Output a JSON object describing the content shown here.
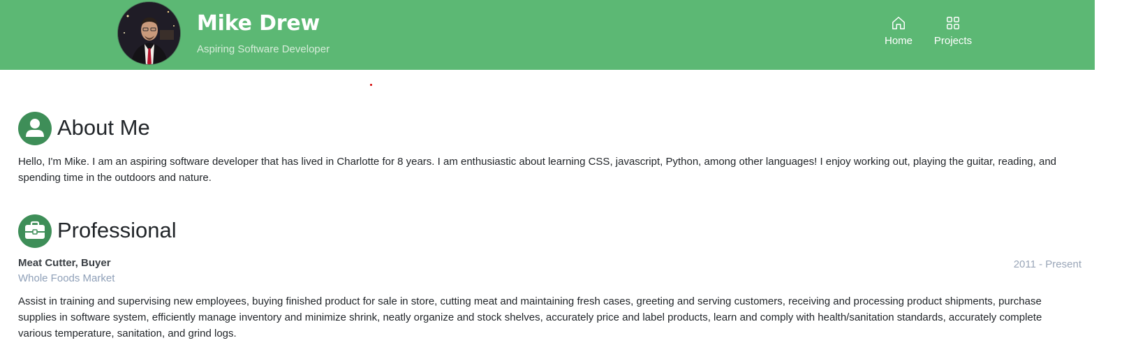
{
  "header": {
    "name": "Mike Drew",
    "tagline": "Aspiring Software Developer",
    "background_color": "#5cb874",
    "nav": [
      {
        "label": "Home",
        "icon": "home-icon"
      },
      {
        "label": "Projects",
        "icon": "grid-icon"
      }
    ]
  },
  "about": {
    "title": "About Me",
    "icon": "person-icon",
    "text": "Hello, I'm Mike. I am an aspiring software developer that has lived in Charlotte for 8 years. I am enthusiastic about learning CSS, javascript, Python, among other languages! I enjoy working out, playing the guitar, reading, and spending time in the outdoors and nature."
  },
  "professional": {
    "title": "Professional",
    "icon": "briefcase-icon",
    "jobs": [
      {
        "title": "Meat Cutter, Buyer",
        "company": "Whole Foods Market",
        "dates": "2011 - Present",
        "description": "Assist in training and supervising new employees, buying finished product for sale in store, cutting meat and maintaining fresh cases, greeting and serving customers, receiving and processing product shipments, purchase supplies in software system, efficiently manage inventory and minimize shrink, neatly organize and stock shelves, accurately price and label products, learn and comply with health/sanitation standards, accurately complete various temperature, sanitation, and grind logs."
      }
    ]
  },
  "colors": {
    "accent": "#5cb874",
    "icon_circle": "#3e8e58",
    "muted_text": "#8fa0b8"
  }
}
